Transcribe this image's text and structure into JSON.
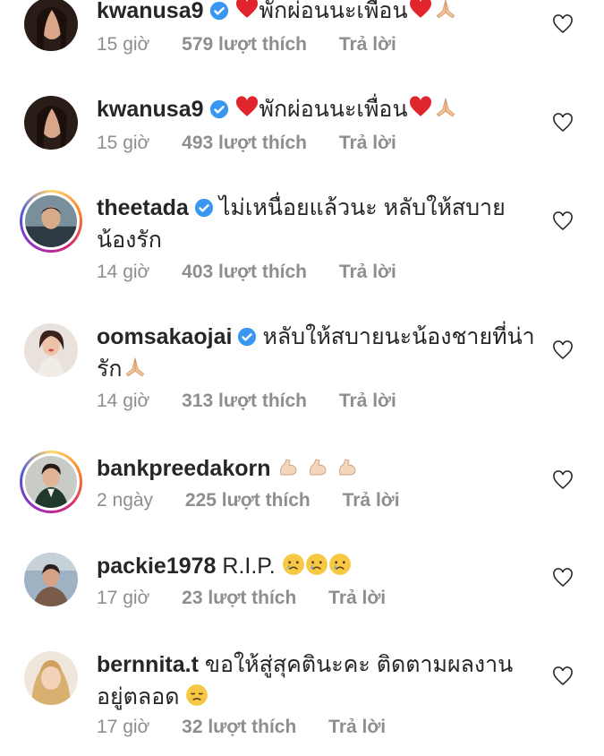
{
  "comments": [
    {
      "username": "kwanusa9",
      "verified": true,
      "text": "พักผ่อนนะเพื่อน",
      "time": "15 giờ",
      "likes": "579 lượt thích",
      "reply": "Trả lời"
    },
    {
      "username": "kwanusa9",
      "verified": true,
      "text": "พักผ่อนนะเพื่อน",
      "time": "15 giờ",
      "likes": "493 lượt thích",
      "reply": "Trả lời"
    },
    {
      "username": "theetada",
      "verified": true,
      "text": "ไม่เหนื่อยแล้วนะ หลับให้สบายน้องรัก",
      "time": "14 giờ",
      "likes": "403 lượt thích",
      "reply": "Trả lời"
    },
    {
      "username": "oomsakaojai",
      "verified": true,
      "text": "หลับให้สบายนะน้องชายที่น่ารัก",
      "time": "14 giờ",
      "likes": "313 lượt thích",
      "reply": "Trả lời"
    },
    {
      "username": "bankpreedakorn",
      "verified": false,
      "text": "",
      "time": "2 ngày",
      "likes": "225 lượt thích",
      "reply": "Trả lời"
    },
    {
      "username": "packie1978",
      "verified": false,
      "text": "R.I.P.",
      "time": "17 giờ",
      "likes": "23 lượt thích",
      "reply": "Trả lời"
    },
    {
      "username": "bernnita.t",
      "verified": false,
      "text": "ขอให้สู่สุคตินะคะ ติดตามผลงานอยู่ตลอด",
      "time": "17 giờ",
      "likes": "32 lượt thích",
      "reply": "Trả lời"
    }
  ],
  "colors": {
    "verified": "#3897f0",
    "muted": "#8e8e8e",
    "text": "#262626"
  }
}
